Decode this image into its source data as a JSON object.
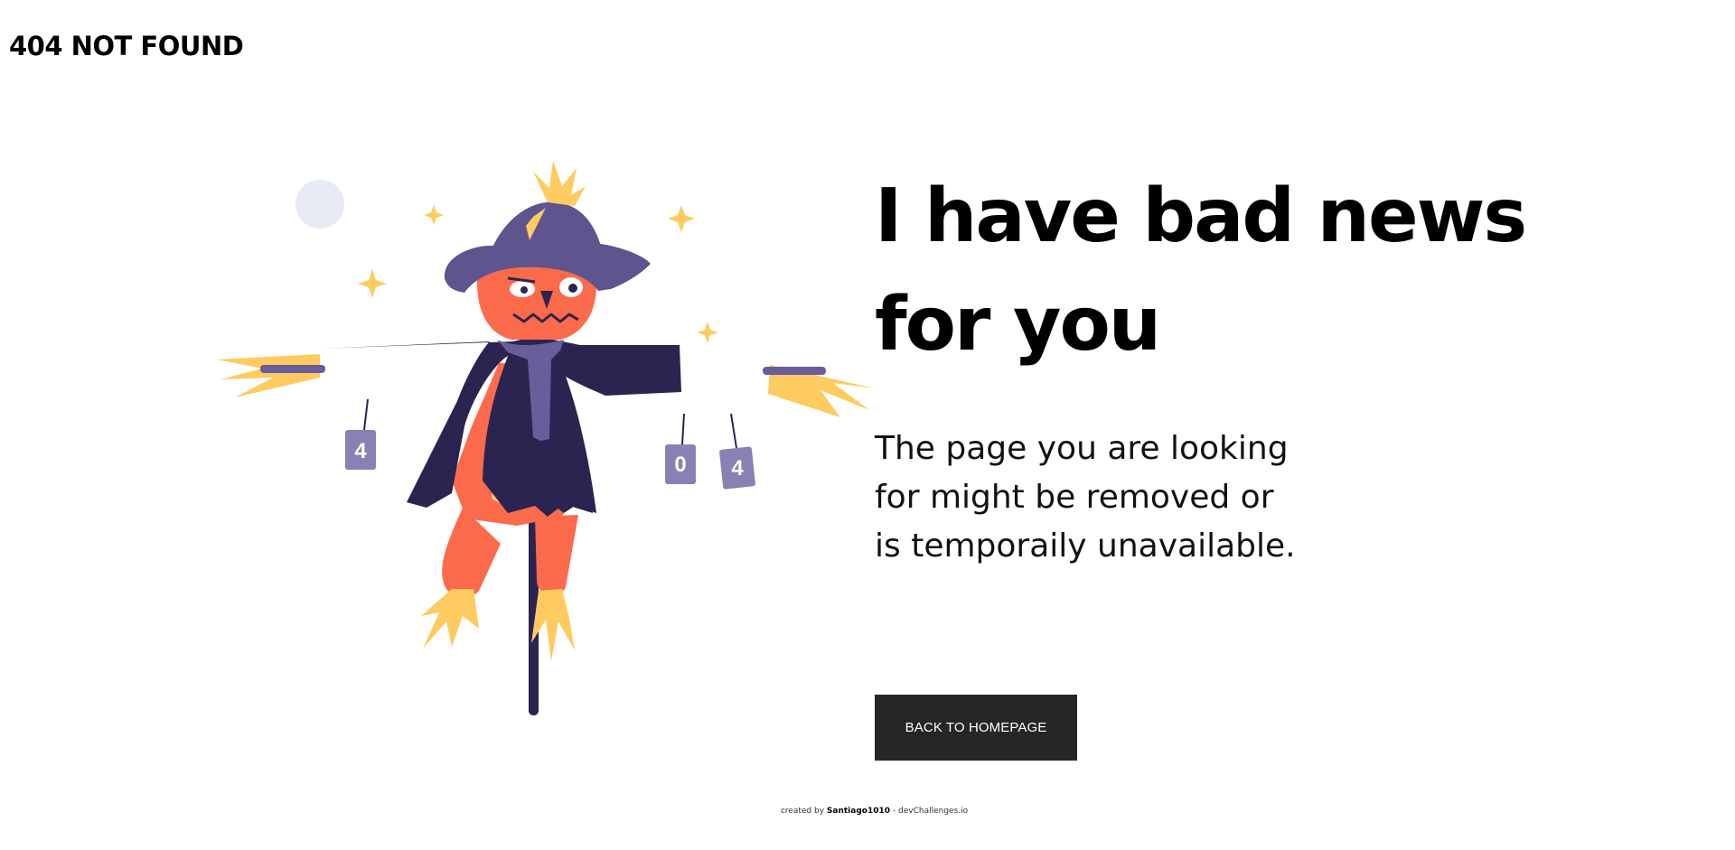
{
  "header": {
    "logo_text": "404 NOT FOUND"
  },
  "illustration": {
    "name": "scarecrow-illustration",
    "can_labels": [
      "4",
      "0",
      "4"
    ],
    "colors": {
      "hat": "#5e548e",
      "coat": "#2b2450",
      "face": "#fc6a4c",
      "straw": "#fdcb5f",
      "scarf": "#6a5d9c",
      "cans": "#8a80b4",
      "moon": "#e8eaf6"
    }
  },
  "main": {
    "headline": "I have bad news for you",
    "description": "The page you are looking for might be removed or is temporaily unavailable.",
    "cta_label": "BACK TO HOMEPAGE"
  },
  "footer": {
    "prefix": "created by",
    "author": "Santiago1010",
    "separator": " - ",
    "site": "devChallenges.io"
  },
  "colors": {
    "button_bg": "#262626",
    "button_text": "#ffffff",
    "text": "#000000"
  }
}
